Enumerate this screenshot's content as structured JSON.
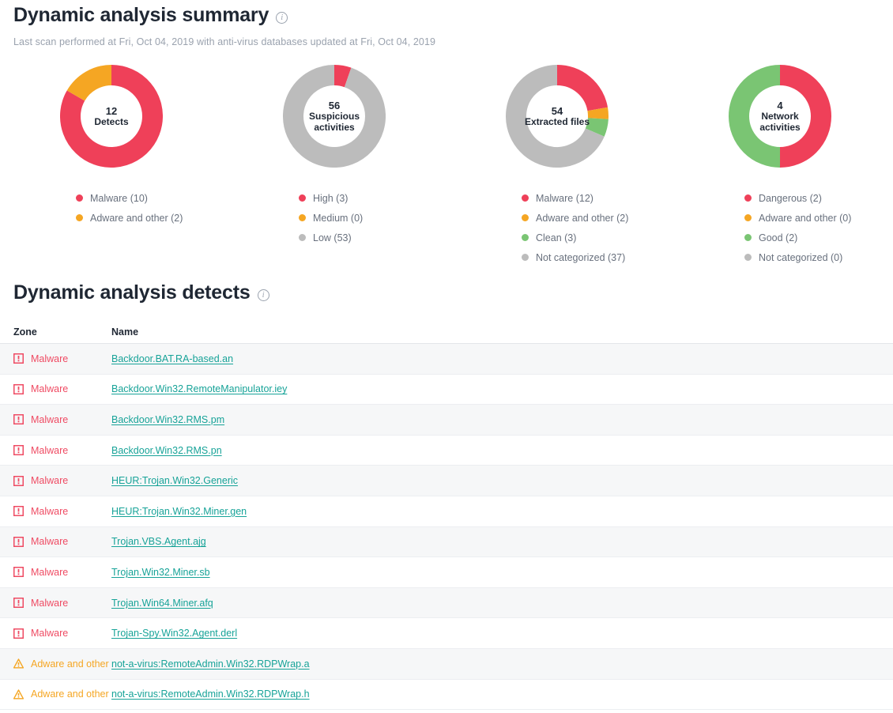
{
  "summary": {
    "title": "Dynamic analysis summary",
    "info_icon": "info-icon",
    "subtitle": "Last scan performed at Fri, Oct 04, 2019 with anti-virus databases updated at Fri, Oct 04, 2019"
  },
  "colors": {
    "red": "#ef4059",
    "orange": "#f5a623",
    "green": "#7ac573",
    "gray": "#bcbcbc",
    "link": "#17a398",
    "text": "#1f2733",
    "muted": "#9aa2ae"
  },
  "charts": [
    {
      "count": "12",
      "label": "Detects",
      "legend": [
        {
          "label": "Malware (10)",
          "color": "#ef4059",
          "value": 10
        },
        {
          "label": "Adware and other (2)",
          "color": "#f5a623",
          "value": 2
        }
      ]
    },
    {
      "count": "56",
      "label": "Suspicious\nactivities",
      "label_line1": "Suspicious",
      "label_line2": "activities",
      "legend": [
        {
          "label": "High (3)",
          "color": "#ef4059",
          "value": 3
        },
        {
          "label": "Medium (0)",
          "color": "#f5a623",
          "value": 0
        },
        {
          "label": "Low (53)",
          "color": "#bcbcbc",
          "value": 53
        }
      ]
    },
    {
      "count": "54",
      "label": "Extracted files",
      "legend": [
        {
          "label": "Malware (12)",
          "color": "#ef4059",
          "value": 12
        },
        {
          "label": "Adware and other (2)",
          "color": "#f5a623",
          "value": 2
        },
        {
          "label": "Clean (3)",
          "color": "#7ac573",
          "value": 3
        },
        {
          "label": "Not categorized (37)",
          "color": "#bcbcbc",
          "value": 37
        }
      ]
    },
    {
      "count": "4",
      "label": "Network\nactivities",
      "label_line1": "Network",
      "label_line2": "activities",
      "legend": [
        {
          "label": "Dangerous (2)",
          "color": "#ef4059",
          "value": 2
        },
        {
          "label": "Adware and other (0)",
          "color": "#f5a623",
          "value": 0
        },
        {
          "label": "Good (2)",
          "color": "#7ac573",
          "value": 2
        },
        {
          "label": "Not categorized (0)",
          "color": "#bcbcbc",
          "value": 0
        }
      ]
    }
  ],
  "chart_data": [
    {
      "type": "pie",
      "title": "12 Detects",
      "total": 12,
      "categories": [
        "Malware",
        "Adware and other"
      ],
      "values": [
        10,
        2
      ],
      "colors": [
        "#ef4059",
        "#f5a623"
      ],
      "legend_position": "bottom-left",
      "donut": true
    },
    {
      "type": "pie",
      "title": "56 Suspicious activities",
      "total": 56,
      "categories": [
        "High",
        "Medium",
        "Low"
      ],
      "values": [
        3,
        0,
        53
      ],
      "colors": [
        "#ef4059",
        "#f5a623",
        "#bcbcbc"
      ],
      "legend_position": "bottom-left",
      "donut": true
    },
    {
      "type": "pie",
      "title": "54 Extracted files",
      "total": 54,
      "categories": [
        "Malware",
        "Adware and other",
        "Clean",
        "Not categorized"
      ],
      "values": [
        12,
        2,
        3,
        37
      ],
      "colors": [
        "#ef4059",
        "#f5a623",
        "#7ac573",
        "#bcbcbc"
      ],
      "legend_position": "bottom-left",
      "donut": true
    },
    {
      "type": "pie",
      "title": "4 Network activities",
      "total": 4,
      "categories": [
        "Dangerous",
        "Adware and other",
        "Good",
        "Not categorized"
      ],
      "values": [
        2,
        0,
        2,
        0
      ],
      "colors": [
        "#ef4059",
        "#f5a623",
        "#7ac573",
        "#bcbcbc"
      ],
      "legend_position": "bottom-left",
      "donut": true
    }
  ],
  "detects": {
    "title": "Dynamic analysis detects",
    "info_icon": "info-icon",
    "columns": {
      "zone": "Zone",
      "name": "Name"
    },
    "rows": [
      {
        "zone": "Malware",
        "zone_type": "malware",
        "icon": "error-square-icon",
        "name": "Backdoor.BAT.RA-based.an"
      },
      {
        "zone": "Malware",
        "zone_type": "malware",
        "icon": "error-square-icon",
        "name": "Backdoor.Win32.RemoteManipulator.iey"
      },
      {
        "zone": "Malware",
        "zone_type": "malware",
        "icon": "error-square-icon",
        "name": "Backdoor.Win32.RMS.pm"
      },
      {
        "zone": "Malware",
        "zone_type": "malware",
        "icon": "error-square-icon",
        "name": "Backdoor.Win32.RMS.pn"
      },
      {
        "zone": "Malware",
        "zone_type": "malware",
        "icon": "error-square-icon",
        "name": "HEUR:Trojan.Win32.Generic"
      },
      {
        "zone": "Malware",
        "zone_type": "malware",
        "icon": "error-square-icon",
        "name": "HEUR:Trojan.Win32.Miner.gen"
      },
      {
        "zone": "Malware",
        "zone_type": "malware",
        "icon": "error-square-icon",
        "name": "Trojan.VBS.Agent.ajg"
      },
      {
        "zone": "Malware",
        "zone_type": "malware",
        "icon": "error-square-icon",
        "name": "Trojan.Win32.Miner.sb"
      },
      {
        "zone": "Malware",
        "zone_type": "malware",
        "icon": "error-square-icon",
        "name": "Trojan.Win64.Miner.afq"
      },
      {
        "zone": "Malware",
        "zone_type": "malware",
        "icon": "error-square-icon",
        "name": "Trojan-Spy.Win32.Agent.derl"
      },
      {
        "zone": "Adware and other",
        "zone_type": "adware",
        "icon": "warning-triangle-icon",
        "name": "not-a-virus:RemoteAdmin.Win32.RDPWrap.a"
      },
      {
        "zone": "Adware and other",
        "zone_type": "adware",
        "icon": "warning-triangle-icon",
        "name": "not-a-virus:RemoteAdmin.Win32.RDPWrap.h"
      }
    ]
  }
}
